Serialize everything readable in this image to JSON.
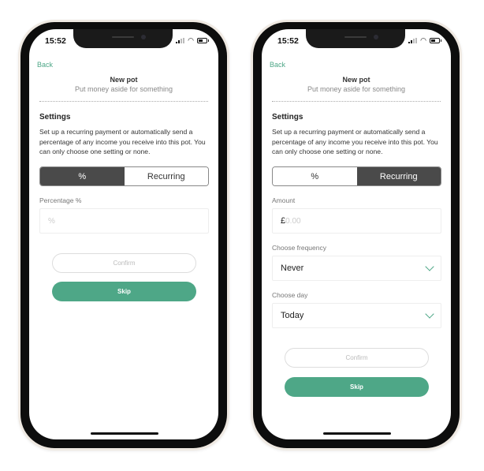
{
  "colors": {
    "accent": "#4ea787",
    "segment_active": "#4a4a4a"
  },
  "screens": [
    {
      "status": {
        "time": "15:52"
      },
      "nav": {
        "back_label": "Back"
      },
      "header": {
        "title": "New pot",
        "subtitle": "Put money aside for something"
      },
      "settings": {
        "title": "Settings",
        "description": "Set up a recurring payment or automatically send a percentage of any income you receive into this pot. You can only choose one setting or none."
      },
      "segment": {
        "options": [
          "%",
          "Recurring"
        ],
        "selected": "%"
      },
      "fields": {
        "percentage_label": "Percentage %",
        "percentage_placeholder": "%"
      },
      "buttons": {
        "confirm": "Confirm",
        "skip": "Skip"
      }
    },
    {
      "status": {
        "time": "15:52"
      },
      "nav": {
        "back_label": "Back"
      },
      "header": {
        "title": "New pot",
        "subtitle": "Put money aside for something"
      },
      "settings": {
        "title": "Settings",
        "description": "Set up a recurring payment or automatically send a percentage of any income you receive into this pot. You can only choose one setting or none."
      },
      "segment": {
        "options": [
          "%",
          "Recurring"
        ],
        "selected": "Recurring"
      },
      "fields": {
        "amount_label": "Amount",
        "amount_currency": "£",
        "amount_placeholder": "0.00",
        "frequency_label": "Choose frequency",
        "frequency_value": "Never",
        "day_label": "Choose day",
        "day_value": "Today"
      },
      "buttons": {
        "confirm": "Confirm",
        "skip": "Skip"
      }
    }
  ]
}
